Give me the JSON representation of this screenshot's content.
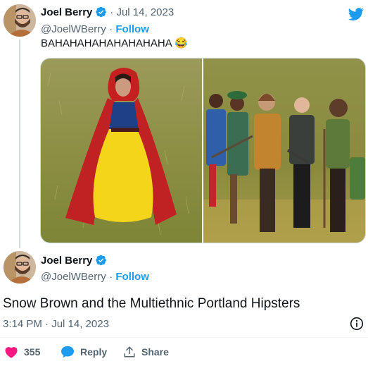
{
  "quoted": {
    "display_name": "Joel Berry",
    "date": "Jul 14, 2023",
    "handle": "@JoelWBerry",
    "follow_label": "Follow",
    "text": "BAHAHAHAHAHAHAHAHA 😂"
  },
  "tweet": {
    "display_name": "Joel Berry",
    "handle": "@JoelWBerry",
    "follow_label": "Follow",
    "text": "Snow Brown and the Multiethnic Portland Hipsters",
    "timestamp": "3:14 PM · Jul 14, 2023"
  },
  "actions": {
    "like_count": "355",
    "reply_label": "Reply",
    "share_label": "Share"
  },
  "colors": {
    "accent": "#1d9bf0",
    "like": "#f91880",
    "muted": "#536471"
  },
  "icons": [
    "twitter-bird-icon",
    "verified-badge-icon",
    "info-icon",
    "heart-icon",
    "reply-bubble-icon",
    "share-icon"
  ]
}
